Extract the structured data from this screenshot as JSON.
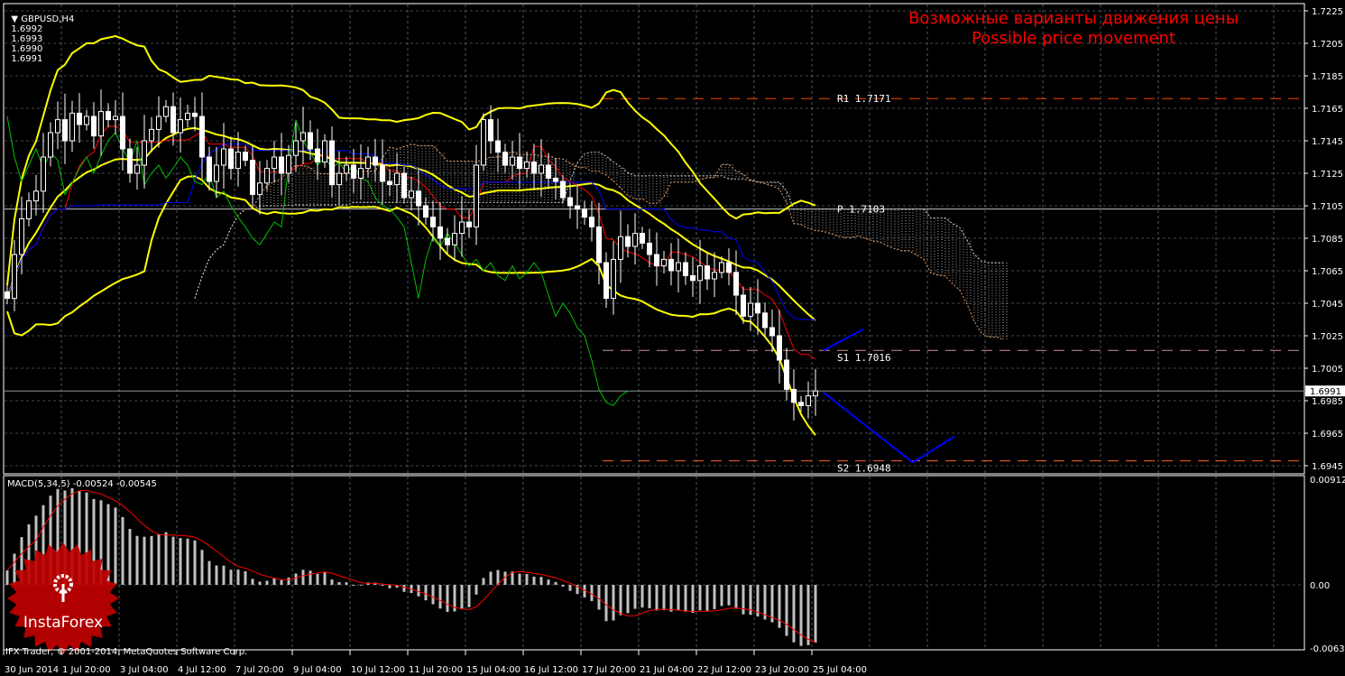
{
  "chart_data": [
    {
      "type": "candlestick",
      "symbol": "GBPUSD,H4",
      "ohlc_header": [
        "1.6992",
        "1.6993",
        "1.6990",
        "1.6991"
      ],
      "title_ru": "Возможные варианты движения цены",
      "title_en": "Possible price movement",
      "ylim": [
        1.6935,
        1.7232
      ],
      "y_ticks": [
        "1.7225",
        "1.7205",
        "1.7185",
        "1.7165",
        "1.7145",
        "1.7125",
        "1.7105",
        "1.7085",
        "1.7065",
        "1.7045",
        "1.7025",
        "1.7005",
        "1.6985",
        "1.6965",
        "1.6945"
      ],
      "x_ticks": [
        "30 Jun 2014",
        "1 Jul 20:00",
        "3 Jul 04:00",
        "4 Jul 12:00",
        "7 Jul 20:00",
        "9 Jul 04:00",
        "10 Jul 12:00",
        "11 Jul 20:00",
        "15 Jul 04:00",
        "16 Jul 12:00",
        "17 Jul 20:00",
        "21 Jul 04:00",
        "22 Jul 12:00",
        "23 Jul 20:00",
        "25 Jul 04:00"
      ],
      "current_price": "1.6991",
      "closes": [
        1.7048,
        1.7075,
        1.7097,
        1.7108,
        1.7114,
        1.7135,
        1.715,
        1.7158,
        1.7145,
        1.7162,
        1.7155,
        1.716,
        1.7148,
        1.7163,
        1.7158,
        1.716,
        1.714,
        1.7125,
        1.713,
        1.7145,
        1.7152,
        1.716,
        1.7166,
        1.715,
        1.7158,
        1.7162,
        1.716,
        1.7135,
        1.712,
        1.713,
        1.714,
        1.7128,
        1.7138,
        1.7133,
        1.7112,
        1.7119,
        1.7128,
        1.7135,
        1.7125,
        1.7136,
        1.7145,
        1.715,
        1.714,
        1.7132,
        1.7145,
        1.7118,
        1.7125,
        1.713,
        1.7122,
        1.7128,
        1.7135,
        1.713,
        1.712,
        1.7118,
        1.7125,
        1.711,
        1.7114,
        1.7105,
        1.7098,
        1.7092,
        1.7085,
        1.7081,
        1.7088,
        1.7095,
        1.7092,
        1.713,
        1.7158,
        1.7145,
        1.7138,
        1.713,
        1.7135,
        1.7128,
        1.7132,
        1.7125,
        1.713,
        1.7122,
        1.712,
        1.711,
        1.7105,
        1.7103,
        1.7098,
        1.7092,
        1.707,
        1.7048,
        1.7072,
        1.7086,
        1.708,
        1.7088,
        1.7082,
        1.7075,
        1.7068,
        1.7072,
        1.7065,
        1.707,
        1.7062,
        1.7059,
        1.7068,
        1.706,
        1.7064,
        1.707,
        1.7064,
        1.705,
        1.7037,
        1.7045,
        1.7039,
        1.703,
        1.7025,
        1.701,
        1.6992,
        1.6984,
        1.6982,
        1.6988,
        1.6991
      ],
      "levels": [
        {
          "label": "R1",
          "value": "1.7171",
          "color": "#ff4500",
          "style": "dashed"
        },
        {
          "label": "P",
          "value": "1.7103",
          "color": "#c0c0c0",
          "style": "solid"
        },
        {
          "label": "S1",
          "value": "1.7016",
          "color": "#c89090",
          "style": "dashed"
        },
        {
          "label": "S2",
          "value": "1.6948",
          "color": "#ff6030",
          "style": "dashed"
        }
      ],
      "forecast_paths": [
        {
          "direction": "up",
          "prices": [
            1.7016,
            1.7029
          ]
        },
        {
          "direction": "down",
          "prices": [
            1.699,
            1.6947,
            1.6963
          ]
        }
      ],
      "indicators": [
        "Bollinger Bands",
        "Ichimoku"
      ],
      "colors": {
        "bull": "#ffffff",
        "bear": "#ffffff",
        "bollinger": "#ffff00",
        "tenkan": "#ff0000",
        "kijun": "#0000ff",
        "chikou": "#00c000",
        "cloud": "#d0d0d0",
        "forecast": "#0000ff",
        "grid": "#8090a0"
      }
    },
    {
      "type": "bar",
      "label": "MACD(5,34,5) -0.00524 -0.00545",
      "y_ticks": [
        "0.00912",
        "0.00",
        "-0.00634"
      ],
      "ylim": [
        -0.00634,
        0.00912
      ],
      "colors": {
        "histogram": "#c0c0c0",
        "signal": "#ff0000"
      }
    }
  ],
  "footer": {
    "copyright": "IFX Trader, © 2001-2014, MetaQuotes Software Corp."
  },
  "logo": {
    "text": "InstaForex",
    "color": "#c00000"
  }
}
